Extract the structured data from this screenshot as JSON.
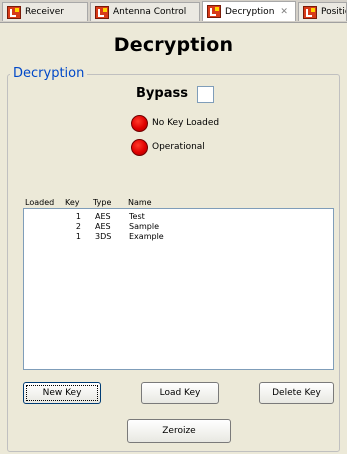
{
  "tabs": [
    {
      "label": "Receiver",
      "icon": "app-logo-icon",
      "active": false
    },
    {
      "label": "Antenna Control",
      "icon": "app-logo-icon",
      "active": false
    },
    {
      "label": "Decryption",
      "icon": "app-logo-icon",
      "active": true,
      "close": "✕"
    },
    {
      "label": "Position",
      "icon": "app-logo-icon",
      "active": false
    }
  ],
  "title": "Decryption",
  "group_label": "Decryption",
  "bypass": {
    "label": "Bypass",
    "checked": false
  },
  "status": [
    {
      "text": "No Key Loaded",
      "color": "#e00000"
    },
    {
      "text": "Operational",
      "color": "#e00000"
    }
  ],
  "list": {
    "headers": [
      "Loaded",
      "Key",
      "Type",
      "Name"
    ],
    "rows": [
      {
        "loaded": "",
        "key": "1",
        "type": "AES",
        "name": "Test"
      },
      {
        "loaded": "",
        "key": "2",
        "type": "AES",
        "name": "Sample"
      },
      {
        "loaded": "",
        "key": "1",
        "type": "3DS",
        "name": "Example"
      }
    ]
  },
  "buttons": {
    "new_key": "New Key",
    "load_key": "Load Key",
    "delete_key": "Delete Key",
    "zeroize": "Zeroize"
  },
  "colors": {
    "accent": "#0048c8",
    "background": "#ece9d8",
    "status_red": "#e00000"
  }
}
